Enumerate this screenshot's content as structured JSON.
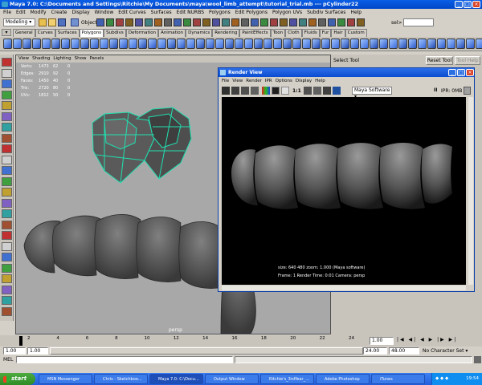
{
  "app": {
    "title": "Maya 7.0: C:\\Documents and Settings\\Ritchie\\My Documents\\maya\\wool_limb_attempt\\tutorial_trial.mb  ---  pCylinder22",
    "menus": [
      "File",
      "Edit",
      "Modify",
      "Create",
      "Display",
      "Window",
      "Edit Curves",
      "Surfaces",
      "Edit NURBS",
      "Polygons",
      "Edit Polygons",
      "Polygon UVs",
      "Subdiv Surfaces",
      "Help"
    ]
  },
  "status_line": {
    "mode": "Modeling",
    "objects_label": "Objects",
    "sel_label": "sel>"
  },
  "shelf": {
    "tabs": [
      "General",
      "Curves",
      "Surfaces",
      "Polygons",
      "Subdivs",
      "Deformation",
      "Animation",
      "Dynamics",
      "Rendering",
      "PaintEffects",
      "Toon",
      "Cloth",
      "Fluids",
      "Fur",
      "Hair",
      "Custom"
    ],
    "active_tab": "Polygons"
  },
  "viewport": {
    "menus": [
      "View",
      "Shading",
      "Lighting",
      "Show",
      "Panels"
    ],
    "hud": [
      {
        "label": "Verts:",
        "a": "1473",
        "b": "62",
        "c": "0"
      },
      {
        "label": "Edges:",
        "a": "2910",
        "b": "92",
        "c": "0"
      },
      {
        "label": "Faces:",
        "a": "1450",
        "b": "40",
        "c": "0"
      },
      {
        "label": "Tris:",
        "a": "2720",
        "b": "80",
        "c": "0"
      },
      {
        "label": "UVs:",
        "a": "1812",
        "b": "50",
        "c": "0"
      }
    ],
    "camera_label": "persp"
  },
  "tool_settings": {
    "title": "Select Tool",
    "reset_label": "Reset Tool",
    "help_label": "Tool Help"
  },
  "render_view": {
    "title": "Render View",
    "menus": [
      "File",
      "View",
      "Render",
      "IPR",
      "Options",
      "Display",
      "Help"
    ],
    "scale": "1:1",
    "renderer": "Maya Software",
    "ipr_label": "IPR: 0MB",
    "info_line1": "size: 640  480 zoom: 1.000      (Maya software)",
    "info_line2": "Frame: 1        Render Time: 0:01        Camera: persp"
  },
  "timeline": {
    "ticks": [
      "1",
      "2",
      "4",
      "6",
      "8",
      "10",
      "12",
      "14",
      "16",
      "18",
      "20",
      "22",
      "24"
    ],
    "current_frame": "1.00"
  },
  "range": {
    "start": "1.00",
    "start2": "1.00",
    "end": "24.00",
    "end2": "48.00",
    "character": "No Character Set"
  },
  "command": {
    "label": "MEL"
  },
  "taskbar": {
    "start_label": "start",
    "items": [
      "MSN Messenger",
      "Chris - Sketchboo...",
      "Maya 7.0: C:\\Docu...",
      "Output Window",
      "Ritchie's_3rdYear_...",
      "Adobe Photoshop",
      "iTunes"
    ],
    "active_index": 2,
    "clock": "19:54"
  },
  "colors": {
    "titlebar": "#0a5ee6",
    "render_bg": "#000000",
    "viewport_bg": "#a8a8a8",
    "wire": "#20e0b0"
  }
}
